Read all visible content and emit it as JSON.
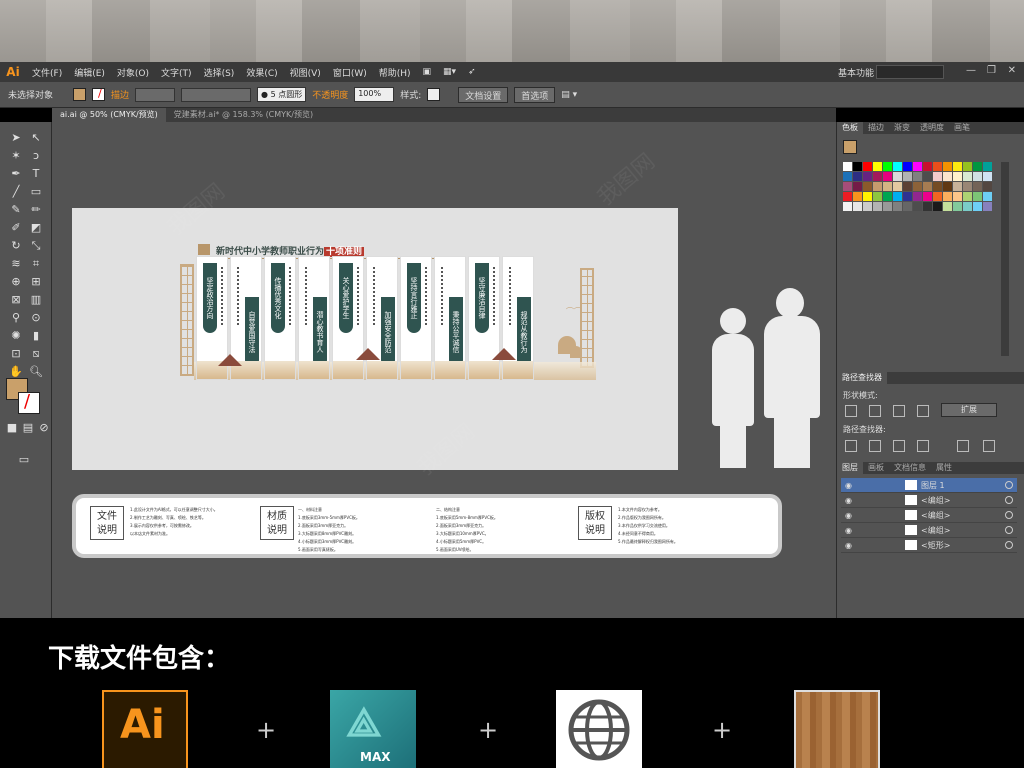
{
  "app": {
    "logo": "Ai",
    "workspace": "基本功能",
    "window_controls": [
      "—",
      "❐",
      "✕"
    ]
  },
  "menu": [
    "文件(F)",
    "编辑(E)",
    "对象(O)",
    "文字(T)",
    "选择(S)",
    "效果(C)",
    "视图(V)",
    "窗口(W)",
    "帮助(H)"
  ],
  "control_bar": {
    "selection": "未选择对象",
    "stroke_label": "描边",
    "brush": "5 点圆形",
    "opacity_label": "不透明度",
    "opacity_value": "100%",
    "style_label": "样式:",
    "doc_setup": "文档设置",
    "preferences": "首选项"
  },
  "tabs": [
    "ai.ai @ 50% (CMYK/预览)",
    "党建素材.ai* @ 158.3% (CMYK/预览)"
  ],
  "design": {
    "title": "新时代中小学教师职业行为",
    "title_tag": "十项准则",
    "panels": [
      "坚定政治方向",
      "自觉爱国守法",
      "传播优秀文化",
      "潜心教书育人",
      "关心爱护学生",
      "加强安全防范",
      "坚持言行雅正",
      "秉持公平诚信",
      "坚守廉洁自律",
      "规范从教行为"
    ]
  },
  "info": {
    "badges": [
      [
        "文件",
        "说明"
      ],
      [
        "材质",
        "说明"
      ],
      [
        "版权",
        "说明"
      ]
    ],
    "col1": [
      "1.此设计文件为AI格式，可以任意调整尺寸大小。",
      "2.制作工艺为雕刻、写真、喷绘、铁艺等。",
      "3.展示内容仅供参考，可按需修改。",
      "以本店文件素材为准。"
    ],
    "col2": [
      "一、材料注意",
      "1.底板采用3mm-5mm厚PVC板。",
      "2.面板采用3mm厚亚克力。",
      "3.大标题采用8mm厚PVC雕刻。",
      "4.小标题采用3mm厚PVC雕刻。",
      "5.画面采用写真裱板。"
    ],
    "col3": [
      "二、结构注意",
      "1.底板采用5mm-8mm厚PVC板。",
      "2.面板采用3mm厚亚克力。",
      "3.大标题采用10mm厚PVC。",
      "4.小标题采用5mm厚PVC。",
      "5.画面采用UV喷绘。"
    ],
    "col4": [
      "1.本文件内容仅为参考。",
      "2.作品版权为我图网所有。",
      "3.本作品仅供学习交流使用。",
      "4.未经同意不得商用。",
      "5.作品最终解释权归我图网所有。"
    ]
  },
  "right_panel": {
    "color_tabs": [
      "色板",
      "描边",
      "渐变",
      "透明度",
      "画笔"
    ],
    "pathfinder_tab": "路径查找器",
    "shape_modes": "形状模式:",
    "pathfinder_label": "路径查找器:",
    "expand": "扩展",
    "layer_tabs": [
      "图层",
      "画板",
      "文档信息",
      "属性"
    ],
    "layers": [
      "图层 1",
      "<编组>",
      "<编组>",
      "<编组>",
      "<矩形>"
    ],
    "swatch_colors": [
      "#ffffff",
      "#000000",
      "#ff0000",
      "#ffff00",
      "#00ff00",
      "#00ffff",
      "#0000ff",
      "#ff00ff",
      "#c8102e",
      "#e94e1b",
      "#f39200",
      "#fcea10",
      "#95c11f",
      "#009640",
      "#00a19a",
      "#1d71b8",
      "#2d2e83",
      "#662483",
      "#a3195b",
      "#e6007e",
      "#d9d9d9",
      "#b3b3b3",
      "#808080",
      "#4d4d4d",
      "#f4cccc",
      "#fce5cd",
      "#fff2cc",
      "#d9ead3",
      "#d0e0e3",
      "#cfe2f3",
      "#a64d79",
      "#741b47",
      "#8b5a2b",
      "#c69c6d",
      "#d4b483",
      "#e3c9a0",
      "#5c4033",
      "#8c6239",
      "#a67c52",
      "#754c24",
      "#603813",
      "#c7b299",
      "#998675",
      "#736357",
      "#534741",
      "#ed1c24",
      "#f7941d",
      "#fff200",
      "#8dc63f",
      "#00a651",
      "#00aeef",
      "#2e3192",
      "#92278f",
      "#ec008c",
      "#f26522",
      "#fbaf5d",
      "#fdc689",
      "#acd373",
      "#7cc576",
      "#6dcff6",
      "#f2f2f2",
      "#e6e6e6",
      "#cccccc",
      "#b3b3b3",
      "#999999",
      "#808080",
      "#666666",
      "#4d4d4d",
      "#333333",
      "#1a1a1a",
      "#c4df9b",
      "#82ca9c",
      "#7accc8",
      "#6ecff6",
      "#8781bd"
    ]
  },
  "bottom": {
    "title": "下载文件包含：",
    "plus": "+",
    "ai_label": "Ai",
    "max_label": "MAX"
  }
}
